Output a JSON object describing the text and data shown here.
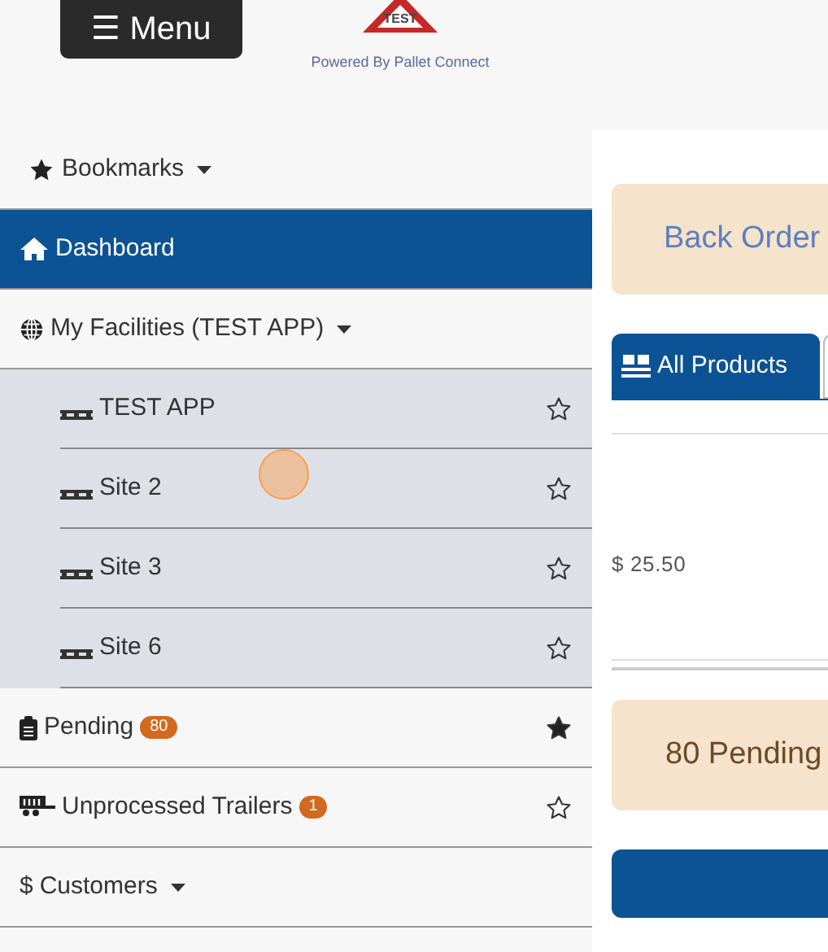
{
  "header": {
    "menu_button": "☰ Menu",
    "logo_badge": "TEST",
    "tagline": "Powered By Pallet Connect"
  },
  "sidebar": {
    "items": [
      {
        "kind": "dropdown",
        "label": "Bookmarks",
        "selected": false
      },
      {
        "kind": "link",
        "label": "Dashboard",
        "selected": true
      },
      {
        "kind": "dropdown",
        "label": "My Facilities (TEST APP)",
        "selected": false,
        "expanded": true,
        "children": [
          {
            "label": "TEST APP",
            "bookmarked": false
          },
          {
            "label": "Site 2",
            "bookmarked": false
          },
          {
            "label": "Site 3",
            "bookmarked": false
          },
          {
            "label": "Site 6",
            "bookmarked": false
          }
        ]
      },
      {
        "kind": "link",
        "label": "Pending",
        "badge": "80",
        "bookmarked": true,
        "selected": false
      },
      {
        "kind": "link",
        "label": "Unprocessed Trailers",
        "badge": "1",
        "bookmarked": false,
        "selected": false
      },
      {
        "kind": "dropdown",
        "symbol": "$",
        "label": "Customers",
        "selected": false
      }
    ]
  },
  "main": {
    "back_order_card": "Back Order",
    "tabs": [
      {
        "label": "All Products",
        "selected": true
      },
      {
        "selected": false
      }
    ],
    "price": "$ 25.50",
    "pending_card": "80 Pending"
  }
}
